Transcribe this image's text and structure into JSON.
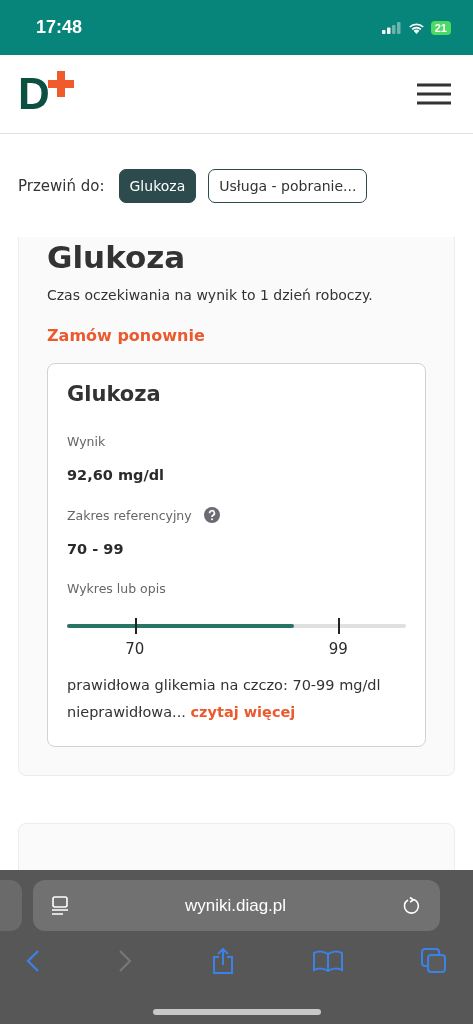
{
  "status_bar": {
    "time": "17:48",
    "battery": "21"
  },
  "header": {
    "logo_letter": "D"
  },
  "scroll_nav": {
    "label": "Przewiń do:",
    "chips": [
      {
        "label": "Glukoza",
        "selected": true
      },
      {
        "label": "Usługa - pobranie...",
        "selected": false
      }
    ]
  },
  "section": {
    "title": "Glukoza",
    "note": "Czas oczekiwania na wynik to 1 dzień roboczy.",
    "reorder_link": "Zamów ponownie",
    "result_card": {
      "title": "Glukoza",
      "result_label": "Wynik",
      "result_value": "92,60 mg/dl",
      "range_label": "Zakres referencyjny",
      "range_value": "70 - 99",
      "chart_label": "Wykres lub opis",
      "gauge": {
        "level": 0.67,
        "low_tick": "70",
        "high_tick": "99"
      },
      "description": "prawidłowa glikemia na czczo: 70-99 mg/dl nieprawidłowa...",
      "more_link": "czytaj więcej"
    }
  },
  "browser": {
    "url": "wyniki.diag.pl"
  }
}
